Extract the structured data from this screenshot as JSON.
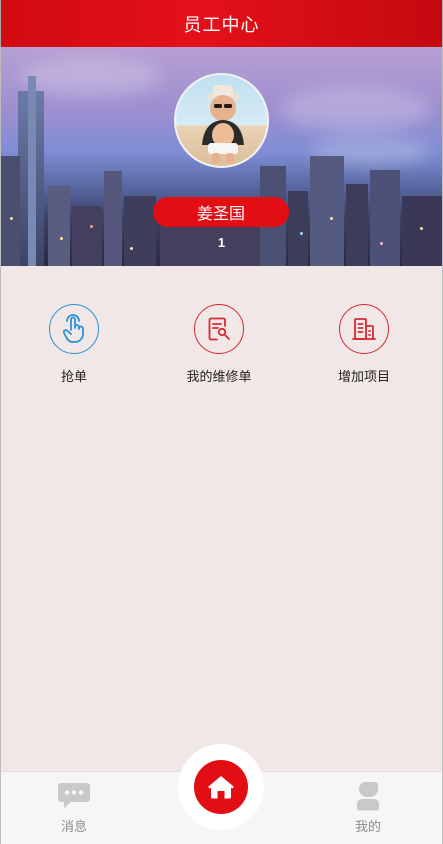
{
  "header": {
    "title": "员工中心"
  },
  "profile": {
    "name": "姜圣国",
    "number": "1"
  },
  "menu": {
    "items": [
      {
        "label": "抢单",
        "icon": "tap-hand-icon",
        "color": "#2a92d6"
      },
      {
        "label": "我的维修单",
        "icon": "repair-order-icon",
        "color": "#d42a32"
      },
      {
        "label": "增加项目",
        "icon": "building-icon",
        "color": "#d42a32"
      }
    ]
  },
  "bottom_nav": {
    "messages_label": "消息",
    "home_icon": "home-icon",
    "mine_label": "我的"
  },
  "colors": {
    "brand_red": "#e30d14",
    "page_bg": "#f2e7e7",
    "accent_blue": "#2a92d6"
  }
}
